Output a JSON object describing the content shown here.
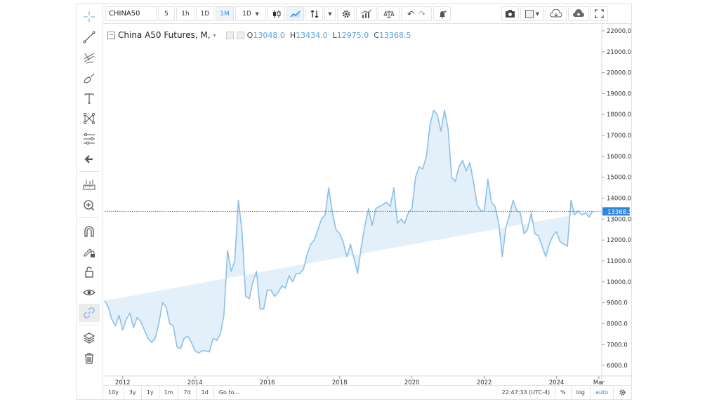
{
  "toolbar": {
    "symbol": "CHINA50",
    "intervals": [
      "5",
      "1h",
      "1D",
      "1M",
      "1D"
    ],
    "active_interval_index": 3
  },
  "left_toolbar": {
    "tools": [
      "crosshair-icon",
      "trend-line-icon",
      "pitchfork-icon",
      "brush-icon",
      "text-icon",
      "pattern-icon",
      "fib-icon",
      "back-arrow-icon",
      "measure-icon",
      "zoom-in-icon",
      "magnet-icon",
      "lock-drawings-icon",
      "unlock-icon",
      "eye-icon",
      "link-icon",
      "layers-icon",
      "trash-icon"
    ],
    "selected": "link-icon"
  },
  "legend": {
    "title": "China A50 Futures, M,",
    "open_label": "O",
    "open": "13048.0",
    "high_label": "H",
    "high": "13434.0",
    "low_label": "L",
    "low": "12975.0",
    "close_label": "C",
    "close": "13368.5"
  },
  "price_label": "13368.5",
  "bottom_bar": {
    "ranges": [
      "10y",
      "3y",
      "1y",
      "1m",
      "7d",
      "1d"
    ],
    "goto": "Go to...",
    "time": "22:47:33 (UTC-4)",
    "percent": "%",
    "log": "log",
    "auto": "auto"
  },
  "colors": {
    "line": "#8dbfe8",
    "fill": "#e3f0fa",
    "accent": "#2e84e0",
    "price_line": "#5a7fa8"
  },
  "chart_data": {
    "type": "area",
    "ylim": [
      5500,
      22300
    ],
    "xlim": [
      2011.5,
      2025.25
    ],
    "y_ticks": [
      6000,
      7000,
      8000,
      9000,
      10000,
      11000,
      12000,
      13000,
      14000,
      15000,
      16000,
      17000,
      18000,
      19000,
      20000,
      21000,
      22000
    ],
    "y_tick_labels": [
      "6000.0",
      "7000.0",
      "8000.0",
      "9000.0",
      "10000.0",
      "11000.0",
      "12000.0",
      "13000.0",
      "14000.0",
      "15000.0",
      "16000.0",
      "17000.0",
      "18000.0",
      "19000.0",
      "20000.0",
      "21000.0",
      "22000.0"
    ],
    "x_ticks": [
      2012,
      2014,
      2016,
      2018,
      2020,
      2022,
      2024,
      2025.17
    ],
    "x_tick_labels": [
      "2012",
      "2014",
      "2016",
      "2018",
      "2020",
      "2022",
      "2024",
      "Mar"
    ],
    "last_value": 13368.5,
    "x": [
      2011.5,
      2011.6,
      2011.7,
      2011.8,
      2011.9,
      2012.0,
      2012.1,
      2012.2,
      2012.3,
      2012.4,
      2012.5,
      2012.6,
      2012.7,
      2012.8,
      2012.9,
      2013.0,
      2013.1,
      2013.2,
      2013.3,
      2013.4,
      2013.5,
      2013.6,
      2013.7,
      2013.8,
      2013.9,
      2014.0,
      2014.1,
      2014.2,
      2014.3,
      2014.4,
      2014.5,
      2014.6,
      2014.7,
      2014.8,
      2014.9,
      2015.0,
      2015.1,
      2015.2,
      2015.3,
      2015.4,
      2015.5,
      2015.6,
      2015.7,
      2015.8,
      2015.9,
      2016.0,
      2016.1,
      2016.2,
      2016.3,
      2016.4,
      2016.5,
      2016.6,
      2016.7,
      2016.8,
      2016.9,
      2017.0,
      2017.1,
      2017.2,
      2017.3,
      2017.4,
      2017.5,
      2017.6,
      2017.7,
      2017.8,
      2017.9,
      2018.0,
      2018.1,
      2018.2,
      2018.3,
      2018.4,
      2018.5,
      2018.6,
      2018.7,
      2018.8,
      2018.9,
      2019.0,
      2019.1,
      2019.2,
      2019.3,
      2019.4,
      2019.5,
      2019.6,
      2019.7,
      2019.8,
      2019.9,
      2020.0,
      2020.1,
      2020.2,
      2020.3,
      2020.4,
      2020.5,
      2020.6,
      2020.7,
      2020.8,
      2020.9,
      2021.0,
      2021.1,
      2021.2,
      2021.3,
      2021.4,
      2021.5,
      2021.6,
      2021.7,
      2021.8,
      2021.9,
      2022.0,
      2022.1,
      2022.2,
      2022.3,
      2022.4,
      2022.5,
      2022.6,
      2022.7,
      2022.8,
      2022.9,
      2023.0,
      2023.1,
      2023.2,
      2023.3,
      2023.4,
      2023.5,
      2023.6,
      2023.7,
      2023.8,
      2023.9,
      2024.0,
      2024.1,
      2024.2,
      2024.3,
      2024.4,
      2024.5,
      2024.6,
      2024.7,
      2024.8,
      2024.9,
      2025.0,
      2025.1,
      2025.2
    ],
    "values": [
      9100,
      8800,
      8200,
      7900,
      8400,
      7700,
      8200,
      8500,
      7800,
      8300,
      8100,
      7700,
      7300,
      7100,
      7300,
      8000,
      9000,
      8800,
      8000,
      7900,
      6900,
      6800,
      7300,
      7400,
      7100,
      6700,
      6600,
      6700,
      6700,
      6650,
      7300,
      7200,
      7500,
      8400,
      11500,
      10500,
      11000,
      13900,
      12400,
      9300,
      9200,
      10000,
      10500,
      8700,
      8700,
      9600,
      9600,
      9300,
      9500,
      9800,
      9700,
      10300,
      10000,
      10400,
      10400,
      10600,
      11300,
      11800,
      12000,
      12500,
      13000,
      13200,
      14500,
      13300,
      12500,
      12300,
      11900,
      11200,
      11800,
      11100,
      10400,
      11700,
      12700,
      13500,
      12700,
      13500,
      13600,
      13700,
      13800,
      13600,
      14500,
      12800,
      13000,
      12800,
      13300,
      13500,
      15000,
      15500,
      15400,
      16000,
      17500,
      18200,
      18000,
      17200,
      18200,
      17300,
      15000,
      14800,
      15500,
      15800,
      15300,
      15700,
      14800,
      13700,
      13400,
      13400,
      14900,
      13800,
      13600,
      12800,
      11200,
      12600,
      13200,
      13900,
      13400,
      13300,
      12300,
      12500,
      13300,
      12300,
      12200,
      11700,
      11200,
      11800,
      12200,
      12400,
      11900,
      11800,
      11700,
      13900,
      13200,
      13400,
      13200,
      13300,
      13100,
      13368.5
    ]
  }
}
